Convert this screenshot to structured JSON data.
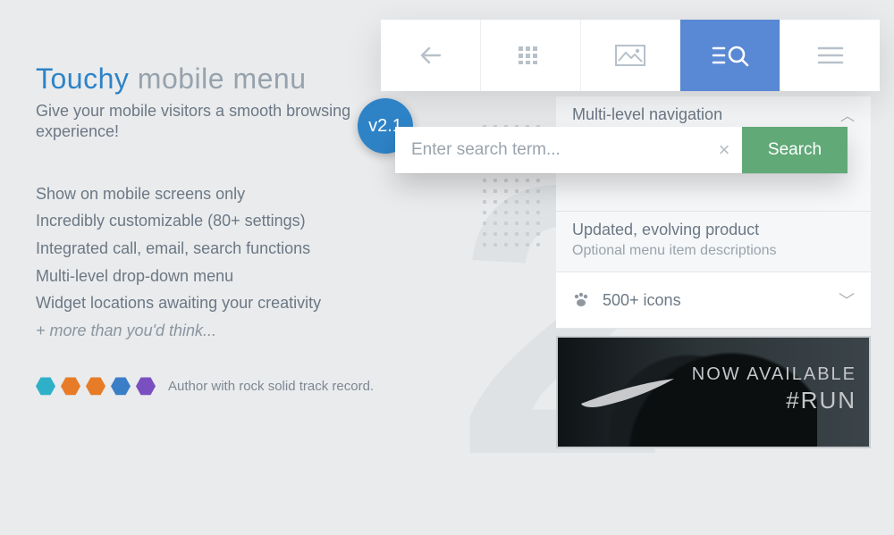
{
  "brand": "Touchy",
  "title_rest": "mobile menu",
  "subtitle": "Give your mobile visitors a smooth browsing experience!",
  "version": "v2.1",
  "features": [
    "Show on mobile screens only",
    "Incredibly customizable (80+ settings)",
    "Integrated call, email, search functions",
    "Multi-level drop-down menu",
    "Widget locations awaiting your creativity"
  ],
  "features_more": "+ more than you'd think...",
  "author_text": "Author with rock solid track record.",
  "badge_colors": [
    "#2fb0c9",
    "#e77b27",
    "#e77b27",
    "#3a7ec7",
    "#7a4fbf"
  ],
  "toolbar": {
    "items": [
      "back",
      "grid",
      "image",
      "search-list",
      "hamburger"
    ],
    "active_index": 3
  },
  "search": {
    "placeholder": "Enter search term...",
    "button": "Search"
  },
  "side": {
    "nav_label": "Multi-level navigation",
    "updated_title": "Updated, evolving product",
    "updated_sub": "Optional menu item descriptions",
    "icons_label": "500+ icons"
  },
  "promo": {
    "line1": "NOW AVAILABLE",
    "line2": "#RUN"
  }
}
